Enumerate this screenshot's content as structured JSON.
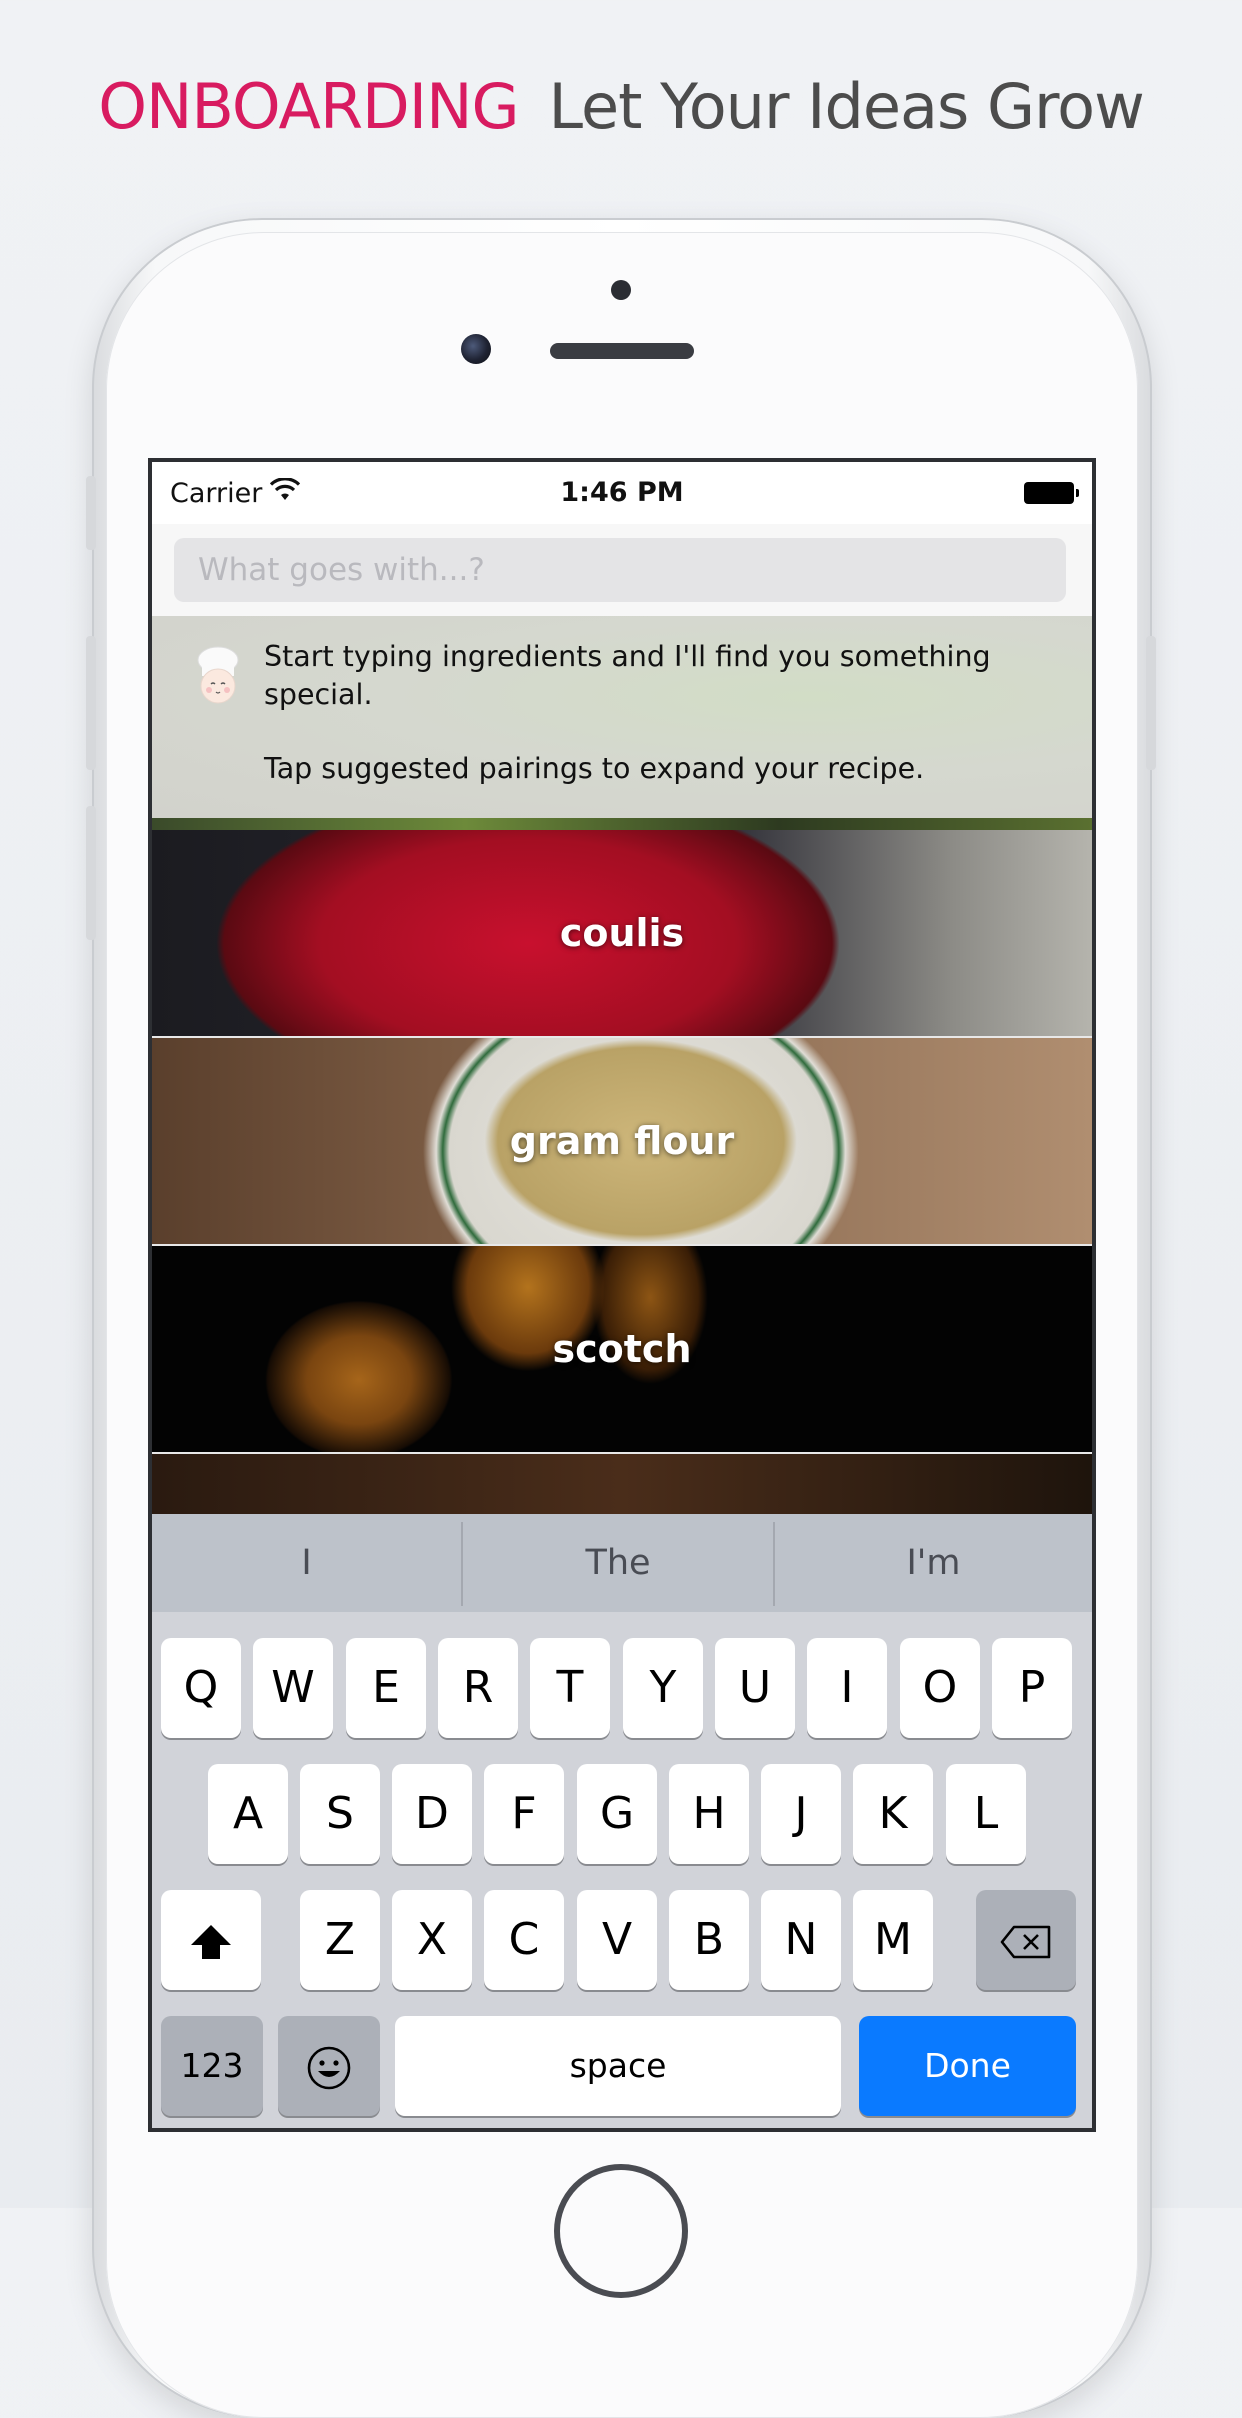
{
  "headline": {
    "tag": "ONBOARDING",
    "subtitle": "Let Your Ideas Grow"
  },
  "status_bar": {
    "carrier": "Carrier",
    "time": "1:46 PM"
  },
  "search": {
    "placeholder": "What goes with...?",
    "value": ""
  },
  "onboarding": {
    "line1": "Start typing ingredients and I'll find you something special.",
    "line2": "Tap suggested pairings to expand your recipe."
  },
  "pairings": [
    {
      "name": "coulis"
    },
    {
      "name": "gram flour"
    },
    {
      "name": "scotch"
    },
    {
      "name": ""
    }
  ],
  "keyboard": {
    "suggestions": [
      "I",
      "The",
      "I'm"
    ],
    "row1": [
      "Q",
      "W",
      "E",
      "R",
      "T",
      "Y",
      "U",
      "I",
      "O",
      "P"
    ],
    "row2": [
      "A",
      "S",
      "D",
      "F",
      "G",
      "H",
      "J",
      "K",
      "L"
    ],
    "row3": [
      "Z",
      "X",
      "C",
      "V",
      "B",
      "N",
      "M"
    ],
    "numbers_label": "123",
    "space_label": "space",
    "done_label": "Done"
  },
  "colors": {
    "accent": "#d81b60",
    "done_button": "#0a7aff"
  },
  "icons": [
    "wifi-icon",
    "battery-icon",
    "chef-icon",
    "shift-icon",
    "backspace-icon",
    "emoji-icon"
  ]
}
